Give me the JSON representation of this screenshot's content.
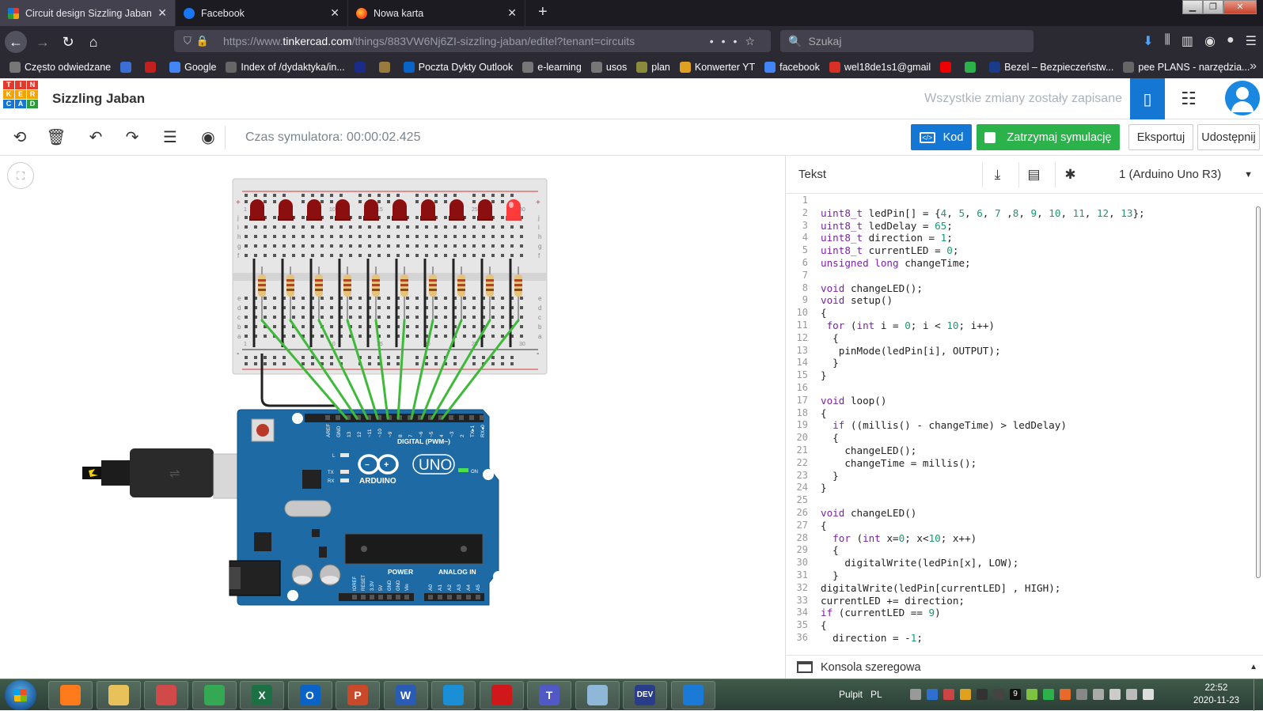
{
  "browser": {
    "tabs": [
      {
        "label": "Circuit design Sizzling Jaban | Ti",
        "active": true,
        "icon": "tinkercad-icon"
      },
      {
        "label": "Facebook",
        "active": false,
        "icon": "facebook-icon"
      },
      {
        "label": "Nowa karta",
        "active": false,
        "icon": "firefox-icon"
      }
    ],
    "url_prefix": "https://www.",
    "url_domain": "tinkercad.com",
    "url_path": "/things/883VW6Nj6ZI-sizzling-jaban/editel?tenant=circuits",
    "search_placeholder": "Szukaj",
    "bookmarks": [
      {
        "label": "Często odwiedzane",
        "icon": "gear-icon",
        "color": "#777"
      },
      {
        "label": "",
        "icon": "play-icon",
        "color": "#3b6fd6"
      },
      {
        "label": "",
        "icon": "cda-icon",
        "color": "#c21f1f"
      },
      {
        "label": "Google",
        "icon": "google-icon",
        "color": "#4285f4"
      },
      {
        "label": "Index of /dydaktyka/in...",
        "icon": "globe-icon",
        "color": "#666"
      },
      {
        "label": "",
        "icon": "bookmark-icon",
        "color": "#1a2b8a"
      },
      {
        "label": "",
        "icon": "bookmark-icon",
        "color": "#9a7b3d"
      },
      {
        "label": "Poczta Dykty Outlook",
        "icon": "outlook-icon",
        "color": "#0a64c8"
      },
      {
        "label": "e-learning",
        "icon": "gear-icon",
        "color": "#777"
      },
      {
        "label": "usos",
        "icon": "gear-icon",
        "color": "#777"
      },
      {
        "label": "plan",
        "icon": "globe-icon",
        "color": "#8a8a3a"
      },
      {
        "label": "Konwerter YT",
        "icon": "bookmark-icon",
        "color": "#e0a020"
      },
      {
        "label": "facebook",
        "icon": "google-icon",
        "color": "#4285f4"
      },
      {
        "label": "wel18de1s1@gmail",
        "icon": "gmail-icon",
        "color": "#d93025"
      },
      {
        "label": "",
        "icon": "youtube-icon",
        "color": "#e00"
      },
      {
        "label": "",
        "icon": "play-store-icon",
        "color": "#2bb24a"
      },
      {
        "label": "Bezel – Bezpieczeństw...",
        "icon": "bezel-icon",
        "color": "#1a3a8a"
      },
      {
        "label": "pee PLANS - narzędzia...",
        "icon": "globe-icon",
        "color": "#666"
      }
    ]
  },
  "header": {
    "logo_letters": [
      "T",
      "I",
      "N",
      "K",
      "E",
      "R",
      "C",
      "A",
      "D"
    ],
    "project_title": "Sizzling Jaban",
    "save_status": "Wszystkie zmiany zostały zapisane"
  },
  "toolbar": {
    "sim_time": "Czas symulatora: 00:00:02.425",
    "code_label": "Kod",
    "stop_label": "Zatrzymaj symulację",
    "export_label": "Eksportuj",
    "share_label": "Udostępnij"
  },
  "board": {
    "digital_label": "DIGITAL (PWM~)",
    "brand": "ARDUINO",
    "model": "UNO",
    "power_label": "POWER",
    "analog_label": "ANALOG IN",
    "on_label": "ON",
    "l_label": "L",
    "tx_label": "TX",
    "rx_label": "RX",
    "digital_pins": [
      "AREF",
      "GND",
      "13",
      "12",
      "~11",
      "~10",
      "~9",
      "8",
      "7",
      "~6",
      "~5",
      "4",
      "~3",
      "2",
      "TX▸1",
      "RX◂0"
    ],
    "power_pins": [
      "IOREF",
      "RESET",
      "3.3V",
      "5V",
      "GND",
      "GND",
      "Vin"
    ],
    "analog_pins": [
      "A0",
      "A1",
      "A2",
      "A3",
      "A4",
      "A5"
    ],
    "breadboard_row_labels": [
      "j",
      "i",
      "h",
      "g",
      "f",
      "e",
      "d",
      "c",
      "b",
      "a"
    ],
    "breadboard_col_labels": [
      "1",
      "5",
      "10",
      "15",
      "20",
      "25",
      "30"
    ],
    "led_states": [
      false,
      false,
      false,
      false,
      false,
      false,
      false,
      false,
      false,
      true
    ]
  },
  "code_panel": {
    "title": "Tekst",
    "device": "1 (Arduino Uno R3)",
    "serial_label": "Konsola szeregowa",
    "lines": [
      "",
      "uint8_t ledPin[] = {4, 5, 6, 7 ,8, 9, 10, 11, 12, 13};",
      "uint8_t ledDelay = 65;",
      "uint8_t direction = 1;",
      "uint8_t currentLED = 0;",
      "unsigned long changeTime;",
      "",
      "void changeLED();",
      "void setup()",
      "{",
      " for (int i = 0; i < 10; i++)",
      "  {",
      "   pinMode(ledPin[i], OUTPUT);",
      "  }",
      "}",
      "",
      "void loop()",
      "{",
      "  if ((millis() - changeTime) > ledDelay)",
      "  {",
      "    changeLED();",
      "    changeTime = millis();",
      "  }",
      "}",
      "",
      "void changeLED()",
      "{",
      "  for (int x=0; x<10; x++)",
      "  {",
      "    digitalWrite(ledPin[x], LOW);",
      "  }",
      "digitalWrite(ledPin[currentLED] , HIGH);",
      "currentLED += direction;",
      "if (currentLED == 9)",
      "{",
      "  direction = -1;"
    ]
  },
  "taskbar": {
    "apps": [
      {
        "name": "firefox",
        "color": "#ff7a1a",
        "letter": ""
      },
      {
        "name": "explorer",
        "color": "#e8c15a",
        "letter": ""
      },
      {
        "name": "snipping",
        "color": "#d04a4a",
        "letter": ""
      },
      {
        "name": "chrome",
        "color": "#34a853",
        "letter": ""
      },
      {
        "name": "excel",
        "color": "#1d7044",
        "letter": "X"
      },
      {
        "name": "outlook",
        "color": "#0a64c8",
        "letter": "O"
      },
      {
        "name": "powerpoint",
        "color": "#c94a2b",
        "letter": "P"
      },
      {
        "name": "word",
        "color": "#2b5cb5",
        "letter": "W"
      },
      {
        "name": "edge",
        "color": "#1a8fd6",
        "letter": ""
      },
      {
        "name": "acrobat",
        "color": "#d0181b",
        "letter": ""
      },
      {
        "name": "teams",
        "color": "#5159c4",
        "letter": "T"
      },
      {
        "name": "notes",
        "color": "#8fb8d8",
        "letter": ""
      },
      {
        "name": "devcpp",
        "color": "#2a3d8a",
        "letter": "DEV"
      },
      {
        "name": "vscode",
        "color": "#1b7ad6",
        "letter": ""
      }
    ],
    "desktop_label": "Pulpit",
    "lang": "PL",
    "tray_number": "9",
    "time": "22:52",
    "date": "2020-11-23"
  },
  "colors": {
    "tinkercad_blue": "#1477d4",
    "sim_green": "#2bb24a",
    "arduino_blue": "#1d6aa5",
    "wire_green": "#3fb93a",
    "led_off": "#8b0f0f",
    "led_on": "#ff3a3a"
  }
}
